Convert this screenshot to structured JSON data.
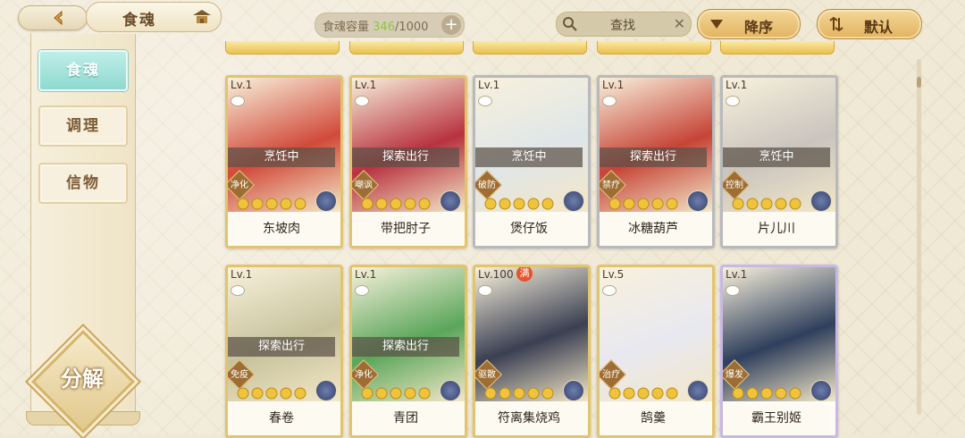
{
  "header": {
    "title": "食魂",
    "capacity_label": "食魂容量",
    "capacity_current": "346",
    "capacity_max": "/1000",
    "plus_label": "+",
    "search_label": "查找",
    "search_clear": "✕",
    "sort_label": "降序",
    "default_label": "默认"
  },
  "sidebar": {
    "tabs": [
      {
        "label": "食魂"
      },
      {
        "label": "调理"
      },
      {
        "label": "信物"
      }
    ],
    "decompose_label": "分解"
  },
  "cards": [
    {
      "level": "Lv.1",
      "status": "烹饪中",
      "tag": "净化",
      "stars": 5,
      "name": "东坡肉",
      "frame": "gold",
      "art": "#d14a3a"
    },
    {
      "level": "Lv.1",
      "status": "探索出行",
      "tag": "嘲讽",
      "stars": 5,
      "name": "带把肘子",
      "frame": "gold",
      "art": "#b8323f"
    },
    {
      "level": "Lv.1",
      "status": "烹饪中",
      "tag": "破防",
      "stars": 5,
      "name": "煲仔饭",
      "frame": "silver",
      "art": "#dfe6e8"
    },
    {
      "level": "Lv.1",
      "status": "探索出行",
      "tag": "禁疗",
      "stars": 5,
      "name": "冰糖葫芦",
      "frame": "silver",
      "art": "#c64437"
    },
    {
      "level": "Lv.1",
      "status": "烹饪中",
      "tag": "控制",
      "stars": 5,
      "name": "片儿川",
      "frame": "silver",
      "art": "#c9c4be"
    },
    {
      "level": "Lv.1",
      "status": "探索出行",
      "tag": "免疫",
      "stars": 5,
      "name": "春卷",
      "frame": "gold",
      "art": "#c7c29c"
    },
    {
      "level": "Lv.1",
      "status": "探索出行",
      "tag": "净化",
      "stars": 5,
      "name": "青团",
      "frame": "gold",
      "art": "#5aa65a"
    },
    {
      "level": "Lv.100",
      "status": "",
      "tag": "驱散",
      "stars": 5,
      "name": "符离集烧鸡",
      "frame": "gold",
      "art": "#3a3f52",
      "full": "满"
    },
    {
      "level": "Lv.5",
      "status": "",
      "tag": "治疗",
      "stars": 5,
      "name": "鹄羹",
      "frame": "gold",
      "art": "#e8e8f0"
    },
    {
      "level": "Lv.1",
      "status": "",
      "tag": "爆发",
      "stars": 5,
      "name": "霸王别姬",
      "frame": "rainbow",
      "art": "#2f3f5c"
    }
  ]
}
